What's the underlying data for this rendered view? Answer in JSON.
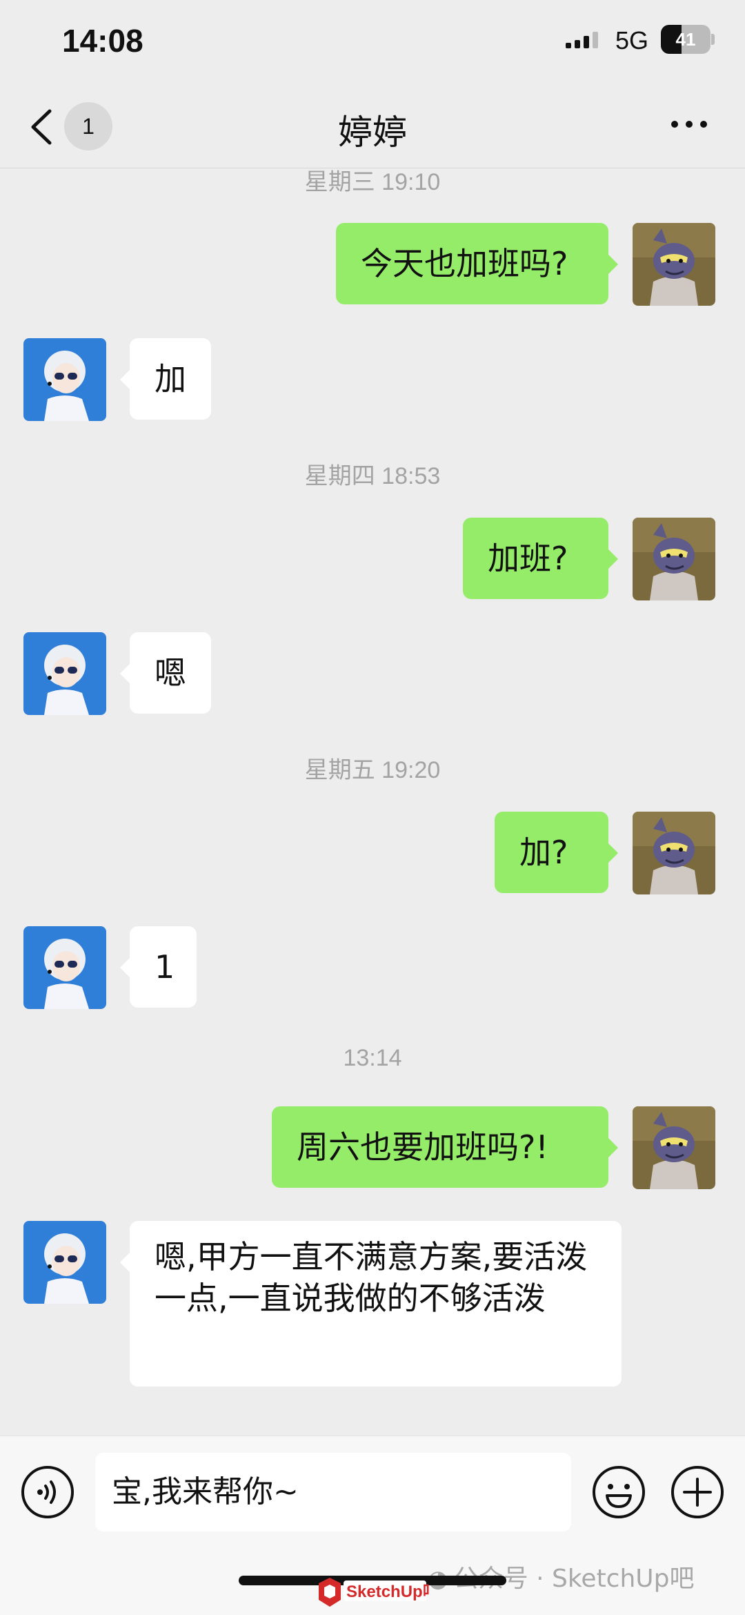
{
  "status_bar": {
    "time": "14:08",
    "network": "5G",
    "battery": "41",
    "battery_level": 0.41
  },
  "header": {
    "unread_count": "1",
    "contact_name": "婷婷"
  },
  "messages": [
    {
      "type": "time",
      "text": "星期三 19:10"
    },
    {
      "type": "out",
      "text": "今天也加班吗?"
    },
    {
      "type": "in",
      "text": "加"
    },
    {
      "type": "time",
      "text": "星期四 18:53"
    },
    {
      "type": "out",
      "text": "加班?"
    },
    {
      "type": "in",
      "text": "嗯"
    },
    {
      "type": "time",
      "text": "星期五 19:20"
    },
    {
      "type": "out",
      "text": "加?"
    },
    {
      "type": "in",
      "text": "1"
    },
    {
      "type": "time",
      "text": "13:14"
    },
    {
      "type": "out",
      "text": "周六也要加班吗?!"
    },
    {
      "type": "in",
      "text": "嗯,甲方一直不满意方案,要活泼一点,一直说我做的不够活泼"
    }
  ],
  "input": {
    "value": "宝,我来帮你~"
  },
  "watermark": {
    "text": "公众号 · SketchUp吧",
    "logo_text": "SketchUp吧"
  },
  "icons": {
    "back": "chevron-left-icon",
    "more": "more-dots-icon",
    "voice": "voice-icon",
    "emoji": "emoji-icon",
    "plus": "plus-icon"
  },
  "colors": {
    "outgoing_bubble": "#95ec69",
    "incoming_bubble": "#ffffff",
    "background": "#ededed"
  }
}
